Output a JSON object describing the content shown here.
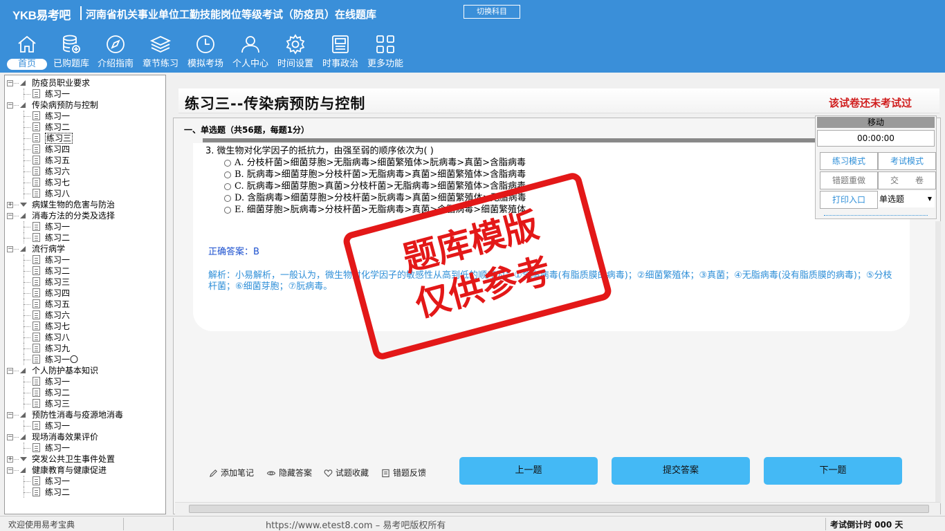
{
  "header": {
    "logo": "YKB易考吧",
    "title": "河南省机关事业单位工勤技能岗位等级考试（防疫员）在线题库",
    "switch_subject": "切换科目"
  },
  "nav": [
    {
      "label": "首页",
      "icon": "home-icon",
      "active": true
    },
    {
      "label": "已购题库",
      "icon": "database-icon"
    },
    {
      "label": "介绍指南",
      "icon": "compass-icon"
    },
    {
      "label": "章节练习",
      "icon": "layers-icon"
    },
    {
      "label": "模拟考场",
      "icon": "clock-icon"
    },
    {
      "label": "个人中心",
      "icon": "user-icon"
    },
    {
      "label": "时间设置",
      "icon": "gear-icon"
    },
    {
      "label": "时事政治",
      "icon": "news-icon"
    },
    {
      "label": "更多功能",
      "icon": "grid-icon"
    }
  ],
  "tree": [
    {
      "type": "folder",
      "label": "防疫员职业要求",
      "state": "open"
    },
    {
      "type": "leaf",
      "label": "练习一"
    },
    {
      "type": "folder",
      "label": "传染病预防与控制",
      "state": "open"
    },
    {
      "type": "leaf",
      "label": "练习一"
    },
    {
      "type": "leaf",
      "label": "练习二"
    },
    {
      "type": "leaf",
      "label": "练习三",
      "selected": true
    },
    {
      "type": "leaf",
      "label": "练习四"
    },
    {
      "type": "leaf",
      "label": "练习五"
    },
    {
      "type": "leaf",
      "label": "练习六"
    },
    {
      "type": "leaf",
      "label": "练习七"
    },
    {
      "type": "leaf",
      "label": "练习八"
    },
    {
      "type": "folder",
      "label": "病媒生物的危害与防治",
      "state": "closed"
    },
    {
      "type": "folder",
      "label": "消毒方法的分类及选择",
      "state": "open"
    },
    {
      "type": "leaf",
      "label": "练习一"
    },
    {
      "type": "leaf",
      "label": "练习二"
    },
    {
      "type": "folder",
      "label": "流行病学",
      "state": "open"
    },
    {
      "type": "leaf",
      "label": "练习一"
    },
    {
      "type": "leaf",
      "label": "练习二"
    },
    {
      "type": "leaf",
      "label": "练习三"
    },
    {
      "type": "leaf",
      "label": "练习四"
    },
    {
      "type": "leaf",
      "label": "练习五"
    },
    {
      "type": "leaf",
      "label": "练习六"
    },
    {
      "type": "leaf",
      "label": "练习七"
    },
    {
      "type": "leaf",
      "label": "练习八"
    },
    {
      "type": "leaf",
      "label": "练习九"
    },
    {
      "type": "leaf",
      "label": "练习一〇"
    },
    {
      "type": "folder",
      "label": "个人防护基本知识",
      "state": "open"
    },
    {
      "type": "leaf",
      "label": "练习一"
    },
    {
      "type": "leaf",
      "label": "练习二"
    },
    {
      "type": "leaf",
      "label": "练习三"
    },
    {
      "type": "folder",
      "label": "预防性消毒与疫源地消毒",
      "state": "open"
    },
    {
      "type": "leaf",
      "label": "练习一"
    },
    {
      "type": "folder",
      "label": "现场消毒效果评价",
      "state": "open"
    },
    {
      "type": "leaf",
      "label": "练习一"
    },
    {
      "type": "folder",
      "label": "突发公共卫生事件处置",
      "state": "closed"
    },
    {
      "type": "folder",
      "label": "健康教育与健康促进",
      "state": "open"
    },
    {
      "type": "leaf",
      "label": "练习一"
    },
    {
      "type": "leaf",
      "label": "练习二"
    }
  ],
  "main": {
    "title": "练习三--传染病预防与控制",
    "exam_status": "该试卷还未考试过",
    "section_title": "一、单选题（共56题，每题1分）",
    "question": {
      "stem": "3. 微生物对化学因子的抵抗力，由强至弱的顺序依次为( )",
      "options": [
        "A. 分枝杆菌>细菌芽胞>无脂病毒>细菌繁殖体>朊病毒>真菌>含脂病毒",
        "B. 朊病毒>细菌芽胞>分枝杆菌>无脂病毒>真菌>细菌繁殖体>含脂病毒",
        "C. 朊病毒>细菌芽胞>真菌>分枝杆菌>无脂病毒>细菌繁殖体>含脂病毒",
        "D. 含脂病毒>细菌芽胞>分枝杆菌>朊病毒>真菌>细菌繁殖体>无脂病毒",
        "E. 细菌芽胞>朊病毒>分枝杆菌>无脂病毒>真菌>含脂病毒>细菌繁殖体"
      ],
      "answer": "正确答案：B",
      "analysis": "解析：小易解析，一般认为，微生物对化学因子的敏感性从高到低的顺序为：①含脂病毒(有脂质膜的病毒)；②细菌繁殖体；③真菌；④无脂病毒(没有脂质膜的病毒)；⑤分枝杆菌；⑥细菌芽胞；⑦朊病毒。"
    },
    "tools": {
      "note": "添加笔记",
      "hide_answer": "隐藏答案",
      "favorite": "试题收藏",
      "feedback": "错题反馈"
    },
    "buttons": {
      "prev": "上一题",
      "submit": "提交答案",
      "next": "下一题"
    }
  },
  "control_panel": {
    "move": "移动",
    "timer": "00:00:00",
    "practice_mode": "练习模式",
    "exam_mode": "考试模式",
    "redo_wrong": "错题重做",
    "hand_in": "交　　卷",
    "print": "打印入口",
    "question_type": "单选题"
  },
  "stamp": {
    "line1": "题库模版",
    "line2": "仅供参考"
  },
  "statusbar": {
    "welcome": "欢迎使用易考宝典",
    "copyright": "https://www.etest8.com – 易考吧版权所有",
    "countdown": "考试倒计时 000 天"
  },
  "colors": {
    "header_bg": "#3a8fd9",
    "accent_button": "#44b9f5",
    "status_red": "#d01e1e",
    "answer_blue": "#1a4fcf",
    "analysis_blue": "#2f8fd8"
  }
}
